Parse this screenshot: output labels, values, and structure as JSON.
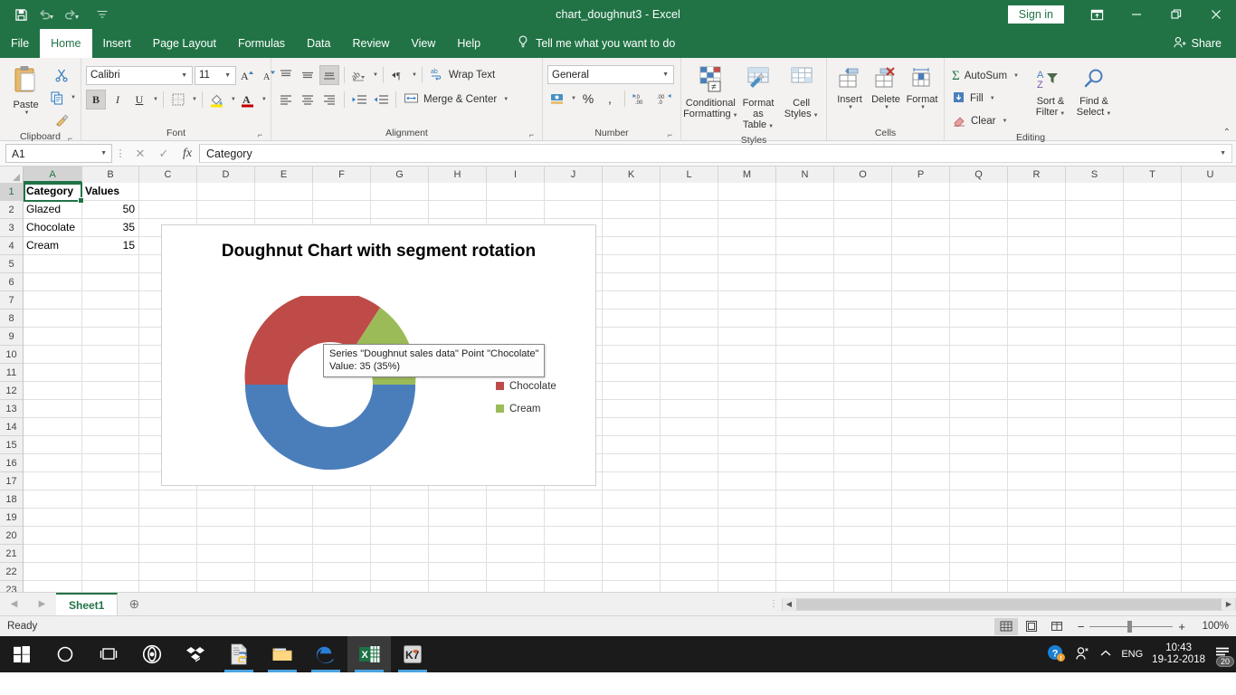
{
  "titlebar": {
    "document_title": "chart_doughnut3  -  Excel",
    "signin_label": "Sign in",
    "quick_access": [
      {
        "name": "save-icon",
        "label": "Save"
      },
      {
        "name": "undo-icon",
        "label": "Undo"
      },
      {
        "name": "redo-icon",
        "label": "Redo"
      },
      {
        "name": "customize-qat-icon",
        "label": "Customize Quick Access Toolbar"
      }
    ],
    "window_buttons": [
      {
        "name": "ribbon-display-options",
        "label": "Ribbon Display Options"
      },
      {
        "name": "minimize-button",
        "label": "Minimize"
      },
      {
        "name": "restore-button",
        "label": "Restore Down"
      },
      {
        "name": "close-button",
        "label": "Close"
      }
    ]
  },
  "ribbon_tabs": {
    "file": "File",
    "items": [
      "Home",
      "Insert",
      "Page Layout",
      "Formulas",
      "Data",
      "Review",
      "View",
      "Help"
    ],
    "active": "Home",
    "tellme": "Tell me what you want to do",
    "share": "Share"
  },
  "ribbon": {
    "clipboard": {
      "label": "Clipboard",
      "paste": "Paste",
      "cut": "Cut",
      "copy": "Copy",
      "format_painter": "Format Painter"
    },
    "font": {
      "label": "Font",
      "font_name": "Calibri",
      "font_size": "11",
      "grow_font": "A",
      "shrink_font": "A",
      "bold": "B",
      "italic": "I",
      "underline": "U",
      "borders": "Borders",
      "fill_color": "Fill Color",
      "font_color": "Font Color"
    },
    "alignment": {
      "label": "Alignment",
      "wrap_text": "Wrap Text",
      "merge_center": "Merge & Center",
      "orientation": "Orientation",
      "text_direction": "Text Direction",
      "decrease_indent": "Decrease Indent",
      "increase_indent": "Increase Indent"
    },
    "number": {
      "label": "Number",
      "format": "General",
      "accounting": "Accounting Number Format",
      "percent": "%",
      "comma": ",",
      "increase_decimal": "Increase Decimal",
      "decrease_decimal": "Decrease Decimal"
    },
    "styles": {
      "label": "Styles",
      "conditional_formatting": "Conditional\nFormatting",
      "conditional_formatting_l1": "Conditional",
      "conditional_formatting_l2": "Formatting",
      "format_as_table_l1": "Format as",
      "format_as_table_l2": "Table",
      "cell_styles_l1": "Cell",
      "cell_styles_l2": "Styles"
    },
    "cells": {
      "label": "Cells",
      "insert": "Insert",
      "delete": "Delete",
      "format": "Format"
    },
    "editing": {
      "label": "Editing",
      "autosum": "AutoSum",
      "fill": "Fill",
      "clear": "Clear",
      "sort_filter_l1": "Sort &",
      "sort_filter_l2": "Filter",
      "find_select_l1": "Find &",
      "find_select_l2": "Select"
    }
  },
  "formula_bar": {
    "name_box": "A1",
    "cancel": "Cancel",
    "enter": "Enter",
    "insert_function": "fx",
    "content": "Category"
  },
  "grid": {
    "columns": [
      "A",
      "B",
      "C",
      "D",
      "E",
      "F",
      "G",
      "H",
      "I",
      "J",
      "K",
      "L",
      "M",
      "N",
      "O",
      "P",
      "Q",
      "R",
      "S",
      "T",
      "U"
    ],
    "selected_column": "A",
    "rows": [
      1,
      2,
      3,
      4,
      5,
      6,
      7,
      8,
      9,
      10,
      11,
      12,
      13,
      14,
      15,
      16,
      17,
      18,
      19,
      20,
      21,
      22,
      23
    ],
    "selected_row": 1,
    "cells": [
      {
        "row": 1,
        "a": "Category",
        "b": "Values",
        "bold": true
      },
      {
        "row": 2,
        "a": "Glazed",
        "b": "50"
      },
      {
        "row": 3,
        "a": "Chocolate",
        "b": "35"
      },
      {
        "row": 4,
        "a": "Cream",
        "b": "15"
      }
    ]
  },
  "chart": {
    "tooltip_line1": "Series \"Doughnut sales data\" Point \"Chocolate\"",
    "tooltip_line2": "Value: 35 (35%)"
  },
  "chart_data": {
    "type": "pie",
    "variant": "doughnut",
    "title": "Doughnut Chart with segment rotation",
    "series_name": "Doughnut sales data",
    "categories": [
      "Glazed",
      "Chocolate",
      "Cream"
    ],
    "values": [
      50,
      35,
      15
    ],
    "percentages": [
      50,
      35,
      15
    ],
    "colors": [
      "#4a7ebb",
      "#be4b48",
      "#9bbb59"
    ],
    "legend": {
      "position": "right",
      "entries": [
        {
          "label": "Glazed",
          "color": "#4a7ebb"
        },
        {
          "label": "Chocolate",
          "color": "#be4b48"
        },
        {
          "label": "Cream",
          "color": "#9bbb59"
        }
      ]
    },
    "first_slice_angle_deg": 270,
    "hole_ratio": 0.5,
    "grid": false,
    "xlabel": "",
    "ylabel": ""
  },
  "sheet_tabs": {
    "tabs": [
      "Sheet1"
    ],
    "active": "Sheet1",
    "add_label": "+",
    "prev": "◀",
    "next": "▶"
  },
  "status_bar": {
    "status": "Ready",
    "views": [
      {
        "name": "normal-view",
        "label": "Normal"
      },
      {
        "name": "page-layout-view",
        "label": "Page Layout"
      },
      {
        "name": "page-break-view",
        "label": "Page Break Preview"
      }
    ],
    "zoom_out": "−",
    "zoom_in": "+",
    "zoom_level": "100%"
  },
  "taskbar": {
    "items": [
      {
        "name": "start-button",
        "label": "Start"
      },
      {
        "name": "cortana-search-icon",
        "label": "Cortana"
      },
      {
        "name": "task-view-icon",
        "label": "Task View"
      },
      {
        "name": "opera-icon",
        "label": "Opera"
      },
      {
        "name": "dropbox-icon",
        "label": "Dropbox"
      },
      {
        "name": "python-file-icon",
        "label": "Python"
      },
      {
        "name": "file-explorer-icon",
        "label": "File Explorer"
      },
      {
        "name": "edge-icon",
        "label": "Microsoft Edge"
      },
      {
        "name": "excel-icon",
        "label": "Excel"
      },
      {
        "name": "k7-security-icon",
        "label": "K7 Security"
      }
    ],
    "language": "ENG",
    "time": "10:43",
    "date": "19-12-2018",
    "notification_count": "20"
  }
}
